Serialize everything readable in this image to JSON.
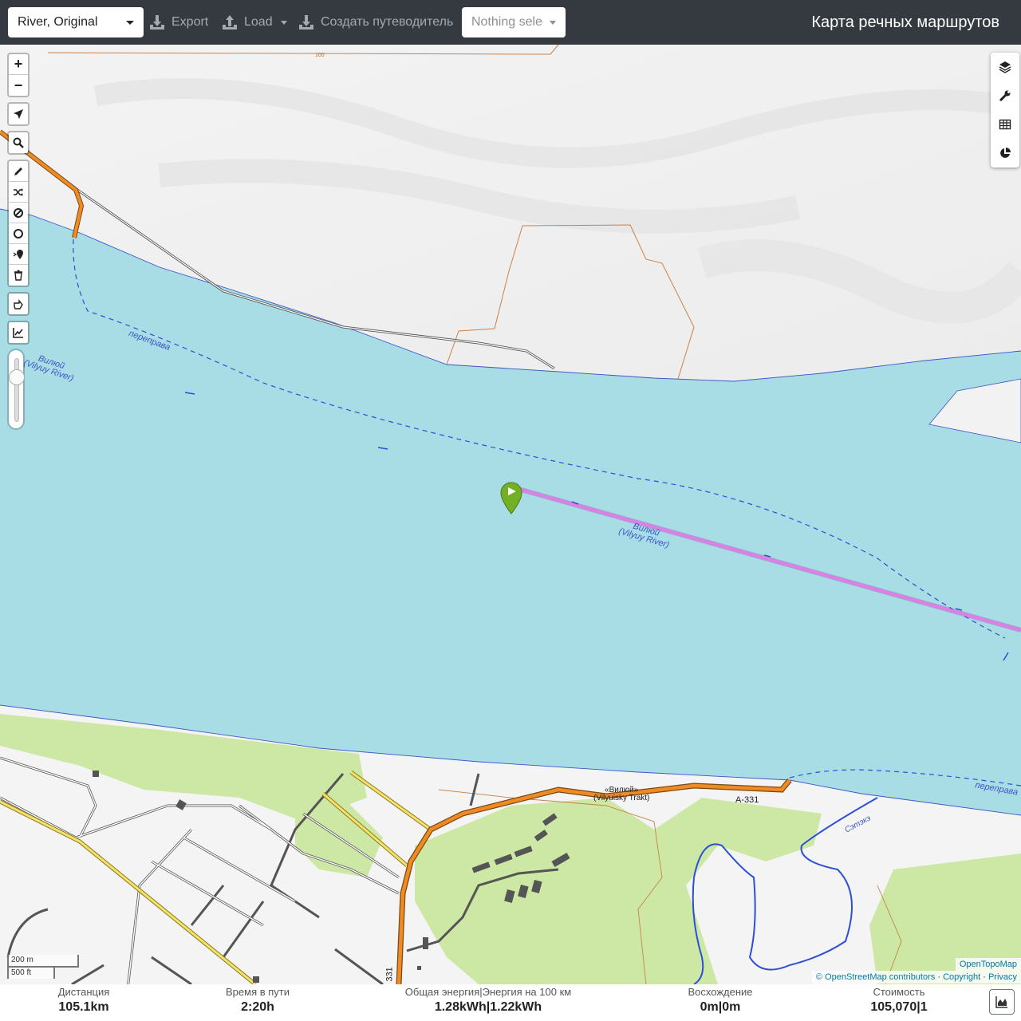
{
  "navbar": {
    "profile_value": "River, Original",
    "export_label": "Export",
    "load_label": "Load",
    "guide_label": "Создать путеводитель",
    "poi_placeholder": "Nothing selected",
    "brand": "Карта речных маршрутов"
  },
  "map_controls": {
    "zoom_in": "+",
    "zoom_out": "−"
  },
  "map_labels": {
    "ferry_label": "переправа",
    "ferry_label_2": "переправа",
    "river_name_1": "Вилюй",
    "river_name_1_en": "(Vilyuy River)",
    "river_name_2": "Вилюй",
    "river_name_2_en": "(Vilyuy River)",
    "road_name": "«Вилюй»",
    "road_name_en": "(Vilyuisky Trakt)",
    "road_ref": "A-331",
    "road_ref_vertical": "331",
    "stream_name": "Сэтэкэ",
    "contour_100": "100"
  },
  "scale": {
    "metric": "200 m",
    "imperial": "500 ft"
  },
  "attribution": {
    "provider": "OpenTopoMap",
    "osm": "© OpenStreetMap contributors",
    "sep1": "·",
    "copyright": "Copyright",
    "sep2": "·",
    "privacy": "Privacy"
  },
  "stats": {
    "distance_label": "Дистанция",
    "distance_value": "105.1",
    "distance_unit": "km",
    "time_label": "Время в пути",
    "time_value": "2:20",
    "time_unit": "h",
    "energy_label": "Общая энергия|Энергия на 100 км",
    "energy_total": "1.28",
    "energy_total_unit": "kWh",
    "energy_sep": "|",
    "energy_per100": "1.22",
    "energy_per100_unit": "kWh",
    "ascent_label": "Восхождение",
    "ascent_up": "0",
    "ascent_up_unit": "m",
    "ascent_sep": "|",
    "ascent_down": "0",
    "ascent_down_unit": "m",
    "cost_label": "Стоимость",
    "cost_value": "105,070",
    "cost_sep": "|",
    "cost_count": "1"
  },
  "colors": {
    "navbar_bg": "#343a40",
    "water": "#a8dde6",
    "route": "#e07ee8",
    "start_marker": "#72b026",
    "major_road": "#f08a24",
    "river_line": "#2b4fd6"
  }
}
